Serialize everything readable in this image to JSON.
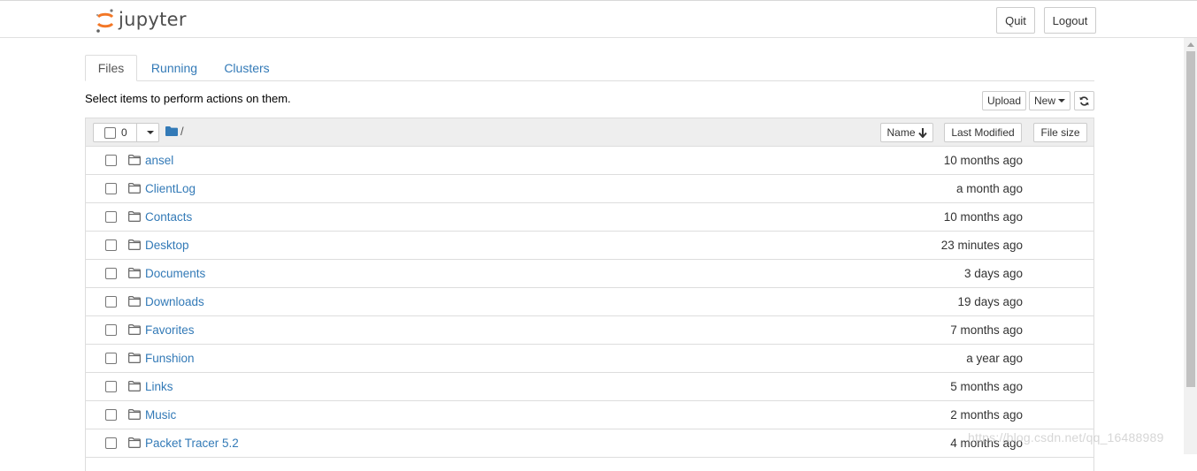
{
  "app": {
    "logo_text": "jupyter",
    "quit_label": "Quit",
    "logout_label": "Logout"
  },
  "tabs": [
    {
      "label": "Files",
      "active": true
    },
    {
      "label": "Running",
      "active": false
    },
    {
      "label": "Clusters",
      "active": false
    }
  ],
  "toolbar": {
    "instructions": "Select items to perform actions on them.",
    "upload_label": "Upload",
    "new_label": "New",
    "refresh_icon": "refresh-icon"
  },
  "list_header": {
    "selected_count": "0",
    "breadcrumb": "/",
    "sort_name_label": "Name",
    "sort_modified_label": "Last Modified",
    "sort_size_label": "File size"
  },
  "files": [
    {
      "name": "ansel",
      "modified": "10 months ago"
    },
    {
      "name": "ClientLog",
      "modified": "a month ago"
    },
    {
      "name": "Contacts",
      "modified": "10 months ago"
    },
    {
      "name": "Desktop",
      "modified": "23 minutes ago"
    },
    {
      "name": "Documents",
      "modified": "3 days ago"
    },
    {
      "name": "Downloads",
      "modified": "19 days ago"
    },
    {
      "name": "Favorites",
      "modified": "7 months ago"
    },
    {
      "name": "Funshion",
      "modified": "a year ago"
    },
    {
      "name": "Links",
      "modified": "5 months ago"
    },
    {
      "name": "Music",
      "modified": "2 months ago"
    },
    {
      "name": "Packet Tracer 5.2",
      "modified": "4 months ago"
    }
  ],
  "watermark": "https://blog.csdn.net/qq_16488989",
  "colors": {
    "link": "#337ab7",
    "logo_orange": "#f37726",
    "header_bg": "#eeeeee",
    "border": "#dddddd"
  }
}
